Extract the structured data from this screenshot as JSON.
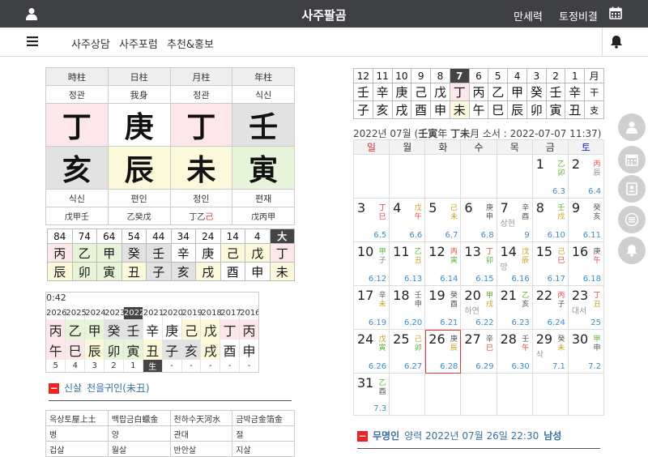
{
  "header": {
    "title": "사주팔곰",
    "menu_manse": "만세력",
    "menu_tojeong": "토정비결"
  },
  "nav": [
    "사주상담",
    "사주포럼",
    "추천&홍보"
  ],
  "saju": {
    "columns": [
      "時柱",
      "日柱",
      "月柱",
      "年柱"
    ],
    "stem_tengods": [
      "정관",
      "我身",
      "정관",
      "식신"
    ],
    "stems": [
      "丁",
      "庚",
      "丁",
      "壬"
    ],
    "branches": [
      "亥",
      "辰",
      "未",
      "寅"
    ],
    "branch_tengods": [
      "식신",
      "편인",
      "정인",
      "편재"
    ],
    "hidden": [
      "戊甲壬",
      "乙癸戊",
      "丁乙",
      "己",
      "戊丙甲"
    ]
  },
  "daeun": {
    "ages": [
      "84",
      "74",
      "64",
      "54",
      "44",
      "34",
      "24",
      "14",
      "4",
      "大"
    ],
    "stems": [
      "丙",
      "乙",
      "甲",
      "癸",
      "壬",
      "辛",
      "庚",
      "己",
      "戊",
      "丁"
    ],
    "branches": [
      "辰",
      "卯",
      "寅",
      "丑",
      "子",
      "亥",
      "戌",
      "酉",
      "申",
      "未"
    ]
  },
  "seun": {
    "time": "0:42",
    "years": [
      "2026",
      "2025",
      "2024",
      "2023",
      "2022",
      "2021",
      "2020",
      "2019",
      "2018",
      "2017",
      "2016"
    ],
    "stems": [
      "丙",
      "乙",
      "甲",
      "癸",
      "壬",
      "辛",
      "庚",
      "己",
      "戊",
      "丁",
      "丙"
    ],
    "branches": [
      "午",
      "巳",
      "辰",
      "卯",
      "寅",
      "丑",
      "子",
      "亥",
      "戌",
      "酉",
      "申"
    ],
    "ages": [
      "5",
      "4",
      "3",
      "2",
      "1",
      "生",
      "-",
      "-",
      "-",
      "-",
      "-"
    ]
  },
  "sinsal": {
    "label": "신살",
    "text": "천을귀인(未丑)"
  },
  "napeum": [
    [
      "옥상토屋上土",
      "백랍금白蠟金",
      "천하수天河水",
      "금박금金箔金"
    ],
    [
      "병",
      "양",
      "관대",
      "절"
    ],
    [
      "겁살",
      "월살",
      "반안살",
      "지살"
    ]
  ],
  "monthly": {
    "months": [
      "12",
      "11",
      "10",
      "9",
      "8",
      "7",
      "6",
      "5",
      "4",
      "3",
      "2",
      "1",
      "月"
    ],
    "stems": [
      "壬",
      "辛",
      "庚",
      "己",
      "戊",
      "丁",
      "丙",
      "乙",
      "甲",
      "癸",
      "壬",
      "辛",
      "干"
    ],
    "branches": [
      "子",
      "亥",
      "戌",
      "酉",
      "申",
      "未",
      "午",
      "巳",
      "辰",
      "卯",
      "寅",
      "丑",
      "支"
    ]
  },
  "calendar": {
    "header_pre": "2022년 07월 (",
    "header_year": "壬寅",
    "header_mid": "年 ",
    "header_month": "丁未",
    "header_post": "月 소서 : 2022-07-07 11:37)",
    "weekdays": [
      "일",
      "월",
      "화",
      "수",
      "목",
      "금",
      "토"
    ],
    "weeks": [
      [
        {},
        {},
        {},
        {},
        {},
        {
          "d": "1",
          "g1": "乙",
          "g2": "卯",
          "c1": "gr",
          "c2": "gr",
          "l": "6.3"
        },
        {
          "d": "2",
          "g1": "丙",
          "g2": "辰",
          "c1": "rd",
          "c2": "gy",
          "l": "6.4"
        }
      ],
      [
        {
          "d": "3",
          "g1": "丁",
          "g2": "巳",
          "c1": "rd",
          "c2": "rd",
          "l": "6.5"
        },
        {
          "d": "4",
          "g1": "戊",
          "g2": "午",
          "c1": "yl",
          "c2": "rd",
          "l": "6.6"
        },
        {
          "d": "5",
          "g1": "己",
          "g2": "未",
          "c1": "yl",
          "c2": "yl",
          "l": "6.7"
        },
        {
          "d": "6",
          "g1": "庚",
          "g2": "申",
          "c1": "bk",
          "c2": "bk",
          "l": "6.8"
        },
        {
          "d": "7",
          "g1": "辛",
          "g2": "酉",
          "c1": "bk",
          "c2": "bk",
          "l": "9",
          "t": "상현"
        },
        {
          "d": "8",
          "g1": "壬",
          "g2": "戌",
          "c1": "gr",
          "c2": "yl",
          "l": "6.10"
        },
        {
          "d": "9",
          "g1": "癸",
          "g2": "亥",
          "c1": "bk",
          "c2": "bk",
          "l": "6.11"
        }
      ],
      [
        {
          "d": "10",
          "g1": "甲",
          "g2": "子",
          "c1": "gr",
          "c2": "gy",
          "l": "6.12"
        },
        {
          "d": "11",
          "g1": "乙",
          "g2": "丑",
          "c1": "gr",
          "c2": "yl",
          "l": "6.13"
        },
        {
          "d": "12",
          "g1": "丙",
          "g2": "寅",
          "c1": "rd",
          "c2": "gr",
          "l": "6.14"
        },
        {
          "d": "13",
          "g1": "丁",
          "g2": "卯",
          "c1": "rd",
          "c2": "gr",
          "l": "6.15"
        },
        {
          "d": "14",
          "g1": "戊",
          "g2": "辰",
          "c1": "yl",
          "c2": "yl",
          "l": "6.16",
          "t": "망"
        },
        {
          "d": "15",
          "g1": "己",
          "g2": "巳",
          "c1": "yl",
          "c2": "rd",
          "l": "6.17"
        },
        {
          "d": "16",
          "g1": "庚",
          "g2": "午",
          "c1": "bk",
          "c2": "rd",
          "l": "6.18"
        }
      ],
      [
        {
          "d": "17",
          "g1": "辛",
          "g2": "未",
          "c1": "bk",
          "c2": "yl",
          "l": "6.19"
        },
        {
          "d": "18",
          "g1": "壬",
          "g2": "申",
          "c1": "bk",
          "c2": "bk",
          "l": "6.20"
        },
        {
          "d": "19",
          "g1": "癸",
          "g2": "酉",
          "c1": "bk",
          "c2": "bk",
          "l": "6.21"
        },
        {
          "d": "20",
          "g1": "甲",
          "g2": "戌",
          "c1": "gr",
          "c2": "yl",
          "l": "6.22",
          "t": "하연"
        },
        {
          "d": "21",
          "g1": "乙",
          "g2": "亥",
          "c1": "gr",
          "c2": "bk",
          "l": "6.23"
        },
        {
          "d": "22",
          "g1": "丙",
          "g2": "子",
          "c1": "rd",
          "c2": "bk",
          "l": "6.24"
        },
        {
          "d": "23",
          "g1": "丁",
          "g2": "丑",
          "c1": "rd",
          "c2": "yl",
          "l": "25",
          "t": "대서"
        }
      ],
      [
        {
          "d": "24",
          "g1": "戊",
          "g2": "寅",
          "c1": "yl",
          "c2": "gr",
          "l": "6.26"
        },
        {
          "d": "25",
          "g1": "己",
          "g2": "卯",
          "c1": "yl",
          "c2": "gr",
          "l": "6.27"
        },
        {
          "d": "26",
          "g1": "庚",
          "g2": "辰",
          "c1": "bk",
          "c2": "yl",
          "l": "6.28",
          "today": true
        },
        {
          "d": "27",
          "g1": "辛",
          "g2": "巳",
          "c1": "bk",
          "c2": "rd",
          "l": "6.29"
        },
        {
          "d": "28",
          "g1": "壬",
          "g2": "午",
          "c1": "bk",
          "c2": "rd",
          "l": "6.30"
        },
        {
          "d": "29",
          "g1": "癸",
          "g2": "未",
          "c1": "bk",
          "c2": "yl",
          "l": "7.1",
          "t": "삭"
        },
        {
          "d": "30",
          "g1": "甲",
          "g2": "申",
          "c1": "gr",
          "c2": "bk",
          "l": "7.2"
        }
      ],
      [
        {
          "d": "31",
          "g1": "乙",
          "g2": "酉",
          "c1": "gr",
          "c2": "bk",
          "l": "7.3"
        },
        {},
        {},
        {},
        {},
        {},
        {}
      ]
    ]
  },
  "profile": {
    "name": "무명인",
    "text": "양력 2022년 07월 26일 22:30",
    "gender": "남성"
  }
}
